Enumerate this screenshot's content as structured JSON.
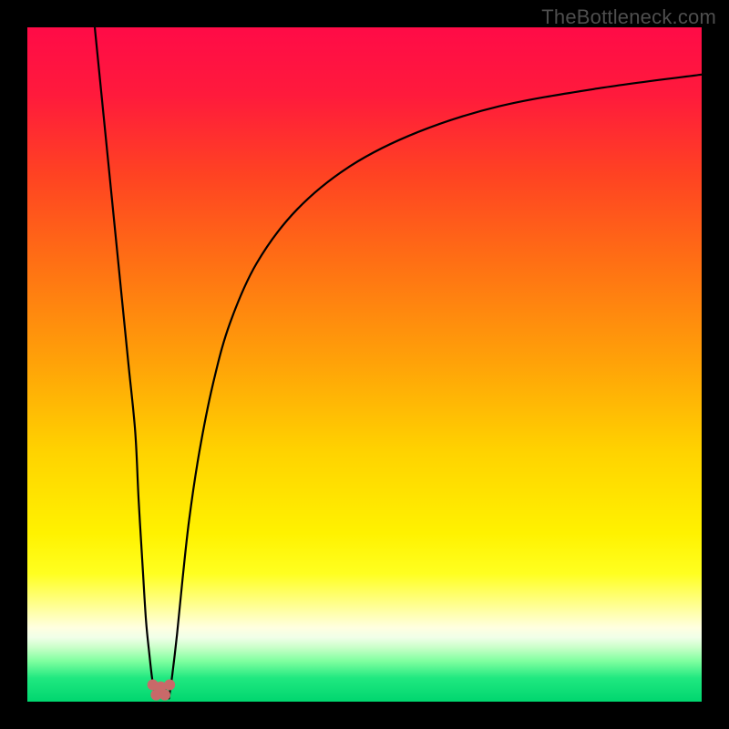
{
  "watermark": "TheBottleneck.com",
  "colors": {
    "frame": "#000000",
    "gradient_stops": [
      {
        "offset": 0.0,
        "color": "#ff0b47"
      },
      {
        "offset": 0.1,
        "color": "#ff1a3c"
      },
      {
        "offset": 0.22,
        "color": "#ff4322"
      },
      {
        "offset": 0.35,
        "color": "#ff7014"
      },
      {
        "offset": 0.5,
        "color": "#ffa308"
      },
      {
        "offset": 0.63,
        "color": "#ffd300"
      },
      {
        "offset": 0.75,
        "color": "#fff200"
      },
      {
        "offset": 0.81,
        "color": "#ffff20"
      },
      {
        "offset": 0.85,
        "color": "#ffff80"
      },
      {
        "offset": 0.89,
        "color": "#ffffe0"
      },
      {
        "offset": 0.905,
        "color": "#f0ffe8"
      },
      {
        "offset": 0.92,
        "color": "#c8ffc8"
      },
      {
        "offset": 0.94,
        "color": "#7fff9f"
      },
      {
        "offset": 0.965,
        "color": "#20e880"
      },
      {
        "offset": 1.0,
        "color": "#00d66f"
      }
    ],
    "curve": "#000000",
    "dots": "#c96969"
  },
  "chart_data": {
    "type": "line",
    "title": "",
    "xlabel": "",
    "ylabel": "",
    "xlim": [
      0,
      100
    ],
    "ylim": [
      0,
      100
    ],
    "grid": false,
    "series": [
      {
        "name": "left-branch",
        "x": [
          10.0,
          11.0,
          12.0,
          13.0,
          14.0,
          15.0,
          16.0,
          16.5,
          17.1,
          17.6,
          18.1,
          18.5,
          19.0
        ],
        "y": [
          100.0,
          90.0,
          80.0,
          70.0,
          60.0,
          50.0,
          40.0,
          30.0,
          20.0,
          12.0,
          7.0,
          3.5,
          0.5
        ]
      },
      {
        "name": "right-branch",
        "x": [
          21.0,
          21.5,
          22.2,
          23.0,
          24.0,
          25.5,
          27.5,
          30.0,
          34.0,
          40.0,
          48.0,
          58.0,
          70.0,
          85.0,
          100.0
        ],
        "y": [
          0.5,
          4.0,
          10.0,
          18.0,
          27.0,
          37.0,
          47.0,
          56.0,
          65.0,
          73.0,
          79.5,
          84.5,
          88.3,
          91.0,
          93.0
        ]
      }
    ],
    "valley": {
      "x_min": 18.5,
      "x_max": 21.5,
      "floor_y": 0.5,
      "dots": [
        {
          "x": 18.6,
          "y": 2.5
        },
        {
          "x": 19.1,
          "y": 1.0
        },
        {
          "x": 19.8,
          "y": 2.2
        },
        {
          "x": 20.4,
          "y": 1.0
        },
        {
          "x": 21.1,
          "y": 2.5
        }
      ]
    }
  }
}
